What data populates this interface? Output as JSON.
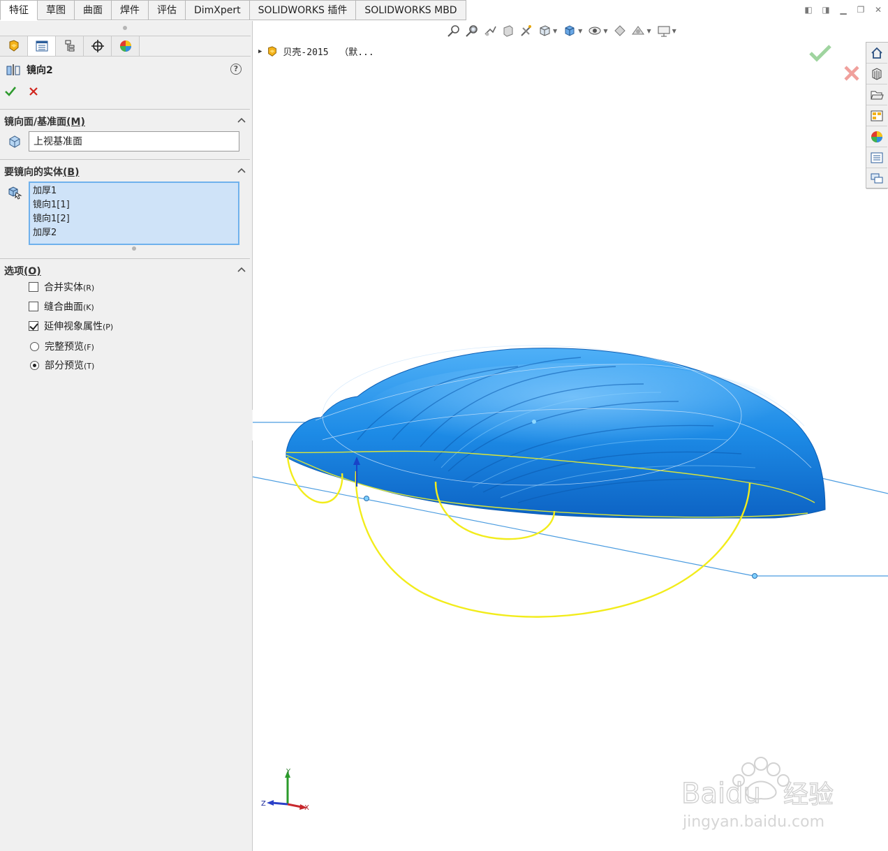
{
  "tabs": [
    "特征",
    "草图",
    "曲面",
    "焊件",
    "评估",
    "DimXpert",
    "SOLIDWORKS 插件",
    "SOLIDWORKS MBD"
  ],
  "active_tab_index": 0,
  "property_manager": {
    "title": "镜向2",
    "help": "?",
    "mirror_plane_group": {
      "label": "镜向面/基准面",
      "mnemonic": "(M)",
      "value": "上视基准面"
    },
    "bodies_group": {
      "label": "要镜向的实体",
      "mnemonic": "(B)",
      "items": [
        "加厚1",
        "镜向1[1]",
        "镜向1[2]",
        "加厚2"
      ]
    },
    "options_group": {
      "label": "选项",
      "mnemonic": "(O)",
      "merge_solids": {
        "label": "合并实体",
        "key": "(R)",
        "checked": false
      },
      "knit_surfaces": {
        "label": "缝合曲面",
        "key": "(K)",
        "checked": false
      },
      "propagate_visual": {
        "label": "延伸视象属性",
        "key": "(P)",
        "checked": true
      },
      "full_preview": {
        "label": "完整预览",
        "key": "(F)",
        "selected": false
      },
      "partial_preview": {
        "label": "部分预览",
        "key": "(T)",
        "selected": true
      }
    }
  },
  "viewport": {
    "tree_flyout": "贝壳-2015  （默...",
    "triad": {
      "x": "X",
      "y": "Y",
      "z": "Z"
    },
    "model_color": "#1f8ee6",
    "sketch_color": "#f2ec1b",
    "plane_color": "#4b9ce0"
  },
  "watermark": {
    "brand": "Baidu",
    "brand_cn": "经验",
    "url": "jingyan.baidu.com"
  }
}
